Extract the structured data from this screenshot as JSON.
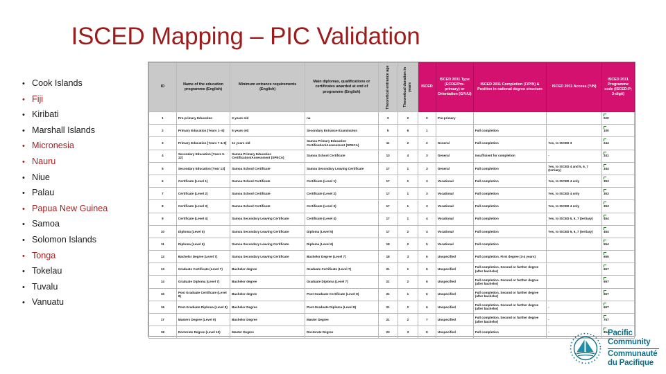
{
  "slide": {
    "title": "ISCED Mapping – PIC Validation"
  },
  "countries": [
    {
      "label": "Cook Islands",
      "highlight": false
    },
    {
      "label": "Fiji",
      "highlight": true
    },
    {
      "label": "Kiribati",
      "highlight": false
    },
    {
      "label": "Marshall Islands",
      "highlight": false
    },
    {
      "label": "Micronesia",
      "highlight": true
    },
    {
      "label": "Nauru",
      "highlight": true
    },
    {
      "label": "Niue",
      "highlight": false
    },
    {
      "label": "Palau",
      "highlight": false
    },
    {
      "label": "Papua New Guinea",
      "highlight": true
    },
    {
      "label": "Samoa",
      "highlight": false
    },
    {
      "label": "Solomon Islands",
      "highlight": false
    },
    {
      "label": "Tonga",
      "highlight": true
    },
    {
      "label": "Tokelau",
      "highlight": false
    },
    {
      "label": "Tuvalu",
      "highlight": false
    },
    {
      "label": "Vanuatu",
      "highlight": false
    }
  ],
  "table": {
    "headers": [
      {
        "text": "ID",
        "style": "grey",
        "rotated": false
      },
      {
        "text": "Name of the education programme (English)",
        "style": "grey",
        "rotated": false
      },
      {
        "text": "Minimum entrance requirements (English)",
        "style": "grey",
        "rotated": false
      },
      {
        "text": "Main diplomas, qualifications or certificates awarded at end of programme (English)",
        "style": "grey",
        "rotated": false
      },
      {
        "text": "Theoretical entrance age",
        "style": "grey",
        "rotated": true
      },
      {
        "text": "Theoretical duration in years",
        "style": "grey",
        "rotated": true
      },
      {
        "text": "ISCED",
        "style": "pink",
        "rotated": false
      },
      {
        "text": "ISCED 2011 Type (ECDE/Pre-primary) or Orientation (G/V/U)",
        "style": "pink",
        "rotated": false
      },
      {
        "text": "ISCED 2011 Completion (F/P/N) & Position in national degree structure",
        "style": "pink",
        "rotated": false
      },
      {
        "text": "ISCED 2011 Access (Y/N)",
        "style": "pink",
        "rotated": false
      },
      {
        "text": "ISCED 2011 Programme code (ISCED-P; 3-digit)",
        "style": "pink",
        "rotated": false
      }
    ],
    "rows": [
      {
        "id": "1",
        "name": "Pre-primary Education",
        "entry": "3 years old",
        "diploma": "na",
        "age": "3",
        "duration": "2",
        "isced": "0",
        "type": "Pre-primary",
        "completion": "",
        "access": "",
        "code": "020"
      },
      {
        "id": "2",
        "name": "Primary Education [Years 1- 6]",
        "entry": "5 years old",
        "diploma": "Secondary Entrance Examination",
        "age": "5",
        "duration": "6",
        "isced": "1",
        "type": "",
        "completion": "Full completion",
        "access": "",
        "code": "100"
      },
      {
        "id": "3",
        "name": "Primary Education [Years 7 & 8]",
        "entry": "11 years old",
        "diploma": "Samoa Primary Education Certification/Assessment (SPECA)",
        "age": "11",
        "duration": "2",
        "isced": "2",
        "type": "General",
        "completion": "Full completion",
        "access": "Yes, to ISCED 3",
        "code": "244"
      },
      {
        "id": "4",
        "name": "Secondary Education [Years 9-12]",
        "entry": "Samoa Primary Education Certification/Assessment (SPECA)",
        "diploma": "Samoa School Certificate",
        "age": "13",
        "duration": "4",
        "isced": "3",
        "type": "General",
        "completion": "Insufficient for completion",
        "access": "-",
        "code": "341"
      },
      {
        "id": "5",
        "name": "Secondary Education [Year 13]",
        "entry": "Samoa School Certificate",
        "diploma": "Samoa Secondary Leaving Certificate",
        "age": "17",
        "duration": "1",
        "isced": "3",
        "type": "General",
        "completion": "Full completion",
        "access": "Yes, to ISCED 4 and 5, 6, 7 (tertiary)",
        "code": "344"
      },
      {
        "id": "6",
        "name": "Certificate (Level 1)",
        "entry": "Samoa School Certificate",
        "diploma": "Certificate (Level 1)",
        "age": "17",
        "duration": "1",
        "isced": "3",
        "type": "Vocational",
        "completion": "Full completion",
        "access": "Yes, to ISCED 4 only",
        "code": "353"
      },
      {
        "id": "7",
        "name": "Certificate (Level 2)",
        "entry": "Samoa School Certificate",
        "diploma": "Certificate (Level 2)",
        "age": "17",
        "duration": "1",
        "isced": "3",
        "type": "Vocational",
        "completion": "Full completion",
        "access": "Yes, to ISCED 4 only",
        "code": "353"
      },
      {
        "id": "8",
        "name": "Certificate (Level 3)",
        "entry": "Samoa School Certificate",
        "diploma": "Certificate (Level 3)",
        "age": "17",
        "duration": "1",
        "isced": "3",
        "type": "Vocational",
        "completion": "Full completion",
        "access": "Yes, to ISCED 4 only",
        "code": "353"
      },
      {
        "id": "9",
        "name": "Certificate (Level 4)",
        "entry": "Samoa Secondary Leaving Certificate",
        "diploma": "Certificate (Level 4)",
        "age": "17",
        "duration": "1",
        "isced": "4",
        "type": "Vocational",
        "completion": "Full completion",
        "access": "Yes, to ISCED 5, 6, 7 (tertiary)",
        "code": "454"
      },
      {
        "id": "10",
        "name": "Diploma (Level 5)",
        "entry": "Samoa Secondary Leaving Certificate",
        "diploma": "Diploma (Level 5)",
        "age": "17",
        "duration": "2",
        "isced": "4",
        "type": "Vocational",
        "completion": "Full completion",
        "access": "Yes, to ISCED 5, 6, 7 (tertiary)",
        "code": "454"
      },
      {
        "id": "11",
        "name": "Diploma (Level 6)",
        "entry": "Samoa Secondary Leaving Certificate",
        "diploma": "Diploma (Level 6)",
        "age": "18",
        "duration": "2",
        "isced": "5",
        "type": "Vocational",
        "completion": "Full completion",
        "access": "",
        "code": "554"
      },
      {
        "id": "12",
        "name": "Bachelor Degree (Level 7)",
        "entry": "Samoa Secondary Leaving Certificate",
        "diploma": "Bachelor Degree (Level 7)",
        "age": "18",
        "duration": "3",
        "isced": "6",
        "type": "Unspecified",
        "completion": "Full completion. First degree (3-4 years)",
        "access": "",
        "code": "655"
      },
      {
        "id": "13",
        "name": "Graduate Certificate (Level 7)",
        "entry": "Bachelor degree",
        "diploma": "Graduate Certificate (Level 7)",
        "age": "21",
        "duration": "1",
        "isced": "6",
        "type": "Unspecified",
        "completion": "Full completion. Second or further degree (after bachelor)",
        "access": "",
        "code": "657"
      },
      {
        "id": "14",
        "name": "Graduate Diploma (Level 7)",
        "entry": "Bachelor degree",
        "diploma": "Graduate Diploma (Level 7)",
        "age": "21",
        "duration": "2",
        "isced": "6",
        "type": "Unspecified",
        "completion": "Full completion. Second or further degree (after bachelor)",
        "access": "",
        "code": "657"
      },
      {
        "id": "15",
        "name": "Post Graduate Certificate (Level 8)",
        "entry": "Bachelor degree",
        "diploma": "Post Graduate Certificate (Level 8)",
        "age": "21",
        "duration": "1",
        "isced": "6",
        "type": "Unspecified",
        "completion": "Full completion. Second or further degree (after bachelor)",
        "access": "",
        "code": "657"
      },
      {
        "id": "16",
        "name": "Post-Graduate Diploma (Level 8)",
        "entry": "Bachelor Degree",
        "diploma": "Post-Graduate Diploma (Level 8)",
        "age": "21",
        "duration": "2",
        "isced": "6",
        "type": "Unspecified",
        "completion": "Full completion. Second or further degree (after bachelor)",
        "access": "-",
        "code": "657"
      },
      {
        "id": "17",
        "name": "Masters Degree (Level 9)",
        "entry": "Bachelor Degree",
        "diploma": "Master Degree",
        "age": "21",
        "duration": "2",
        "isced": "7",
        "type": "Unspecified",
        "completion": "Full completion. Second or further degree (after bachelor)",
        "access": "-",
        "code": "757"
      },
      {
        "id": "18",
        "name": "Doctorate Degree (Level 10)",
        "entry": "Master Degree",
        "diploma": "Doctorate Degree",
        "age": "23",
        "duration": "3",
        "isced": "8",
        "type": "Unspecified",
        "completion": "Full completion",
        "access": "-",
        "code": "854"
      }
    ]
  },
  "logo": {
    "name_en": "Pacific Community",
    "name_fr_line1": "Communauté",
    "name_fr_line2": "du Pacifique"
  },
  "colors": {
    "title_red": "#9E1B1B",
    "highlight_red": "#A32020",
    "header_pink": "#D4116F",
    "header_grey": "#C9C9C9",
    "logo_teal": "#0F6E86"
  }
}
